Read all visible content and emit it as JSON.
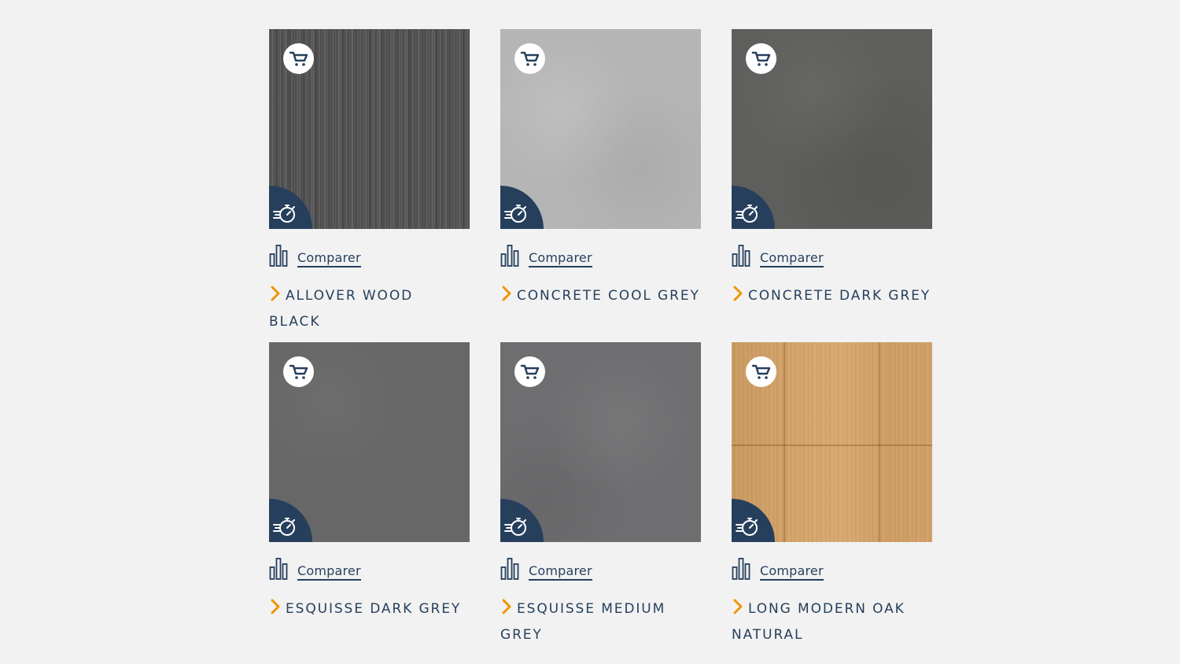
{
  "compare_label": "Comparer",
  "icons": {
    "cart": "shopping-cart-icon",
    "quick": "stopwatch-icon",
    "compare": "bar-chart-icon",
    "chevron": "chevron-right-icon"
  },
  "colors": {
    "background": "#f2f2f2",
    "navy": "#263f5d",
    "accent_orange": "#f29400"
  },
  "products": [
    {
      "title": "ALLOVER WOOD BLACK"
    },
    {
      "title": "CONCRETE COOL GREY"
    },
    {
      "title": "CONCRETE DARK GREY"
    },
    {
      "title": "ESQUISSE DARK GREY"
    },
    {
      "title": "ESQUISSE MEDIUM GREY"
    },
    {
      "title": "LONG MODERN OAK NATURAL"
    }
  ]
}
